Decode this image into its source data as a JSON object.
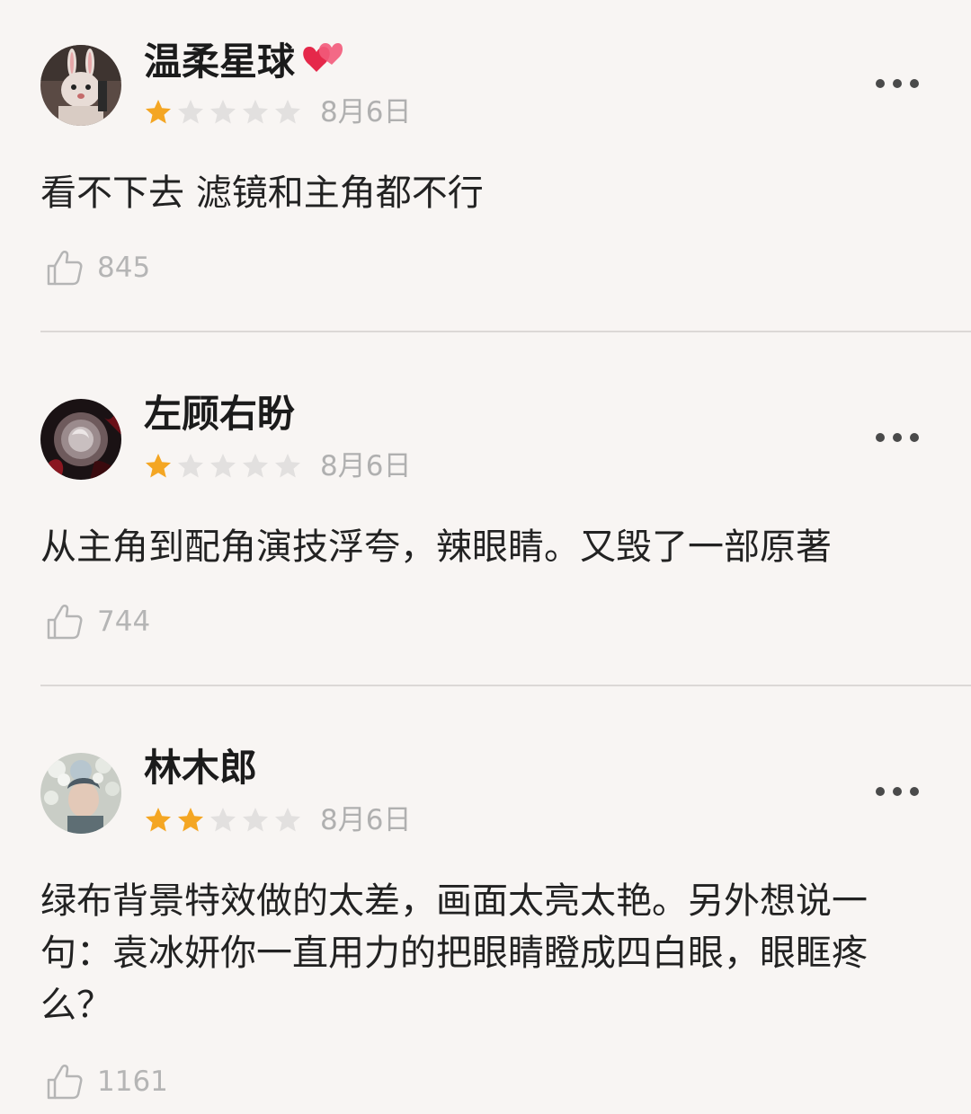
{
  "reviews": [
    {
      "username": "温柔星球",
      "username_emoji": "heart-icon",
      "rating": 1,
      "rating_max": 5,
      "date": "8月6日",
      "content": "看不下去 滤镜和主角都不行",
      "likes": "845"
    },
    {
      "username": "左顾右盼",
      "rating": 1,
      "rating_max": 5,
      "date": "8月6日",
      "content": "从主角到配角演技浮夸，辣眼睛。又毁了一部原著",
      "likes": "744"
    },
    {
      "username": "林木郎",
      "rating": 2,
      "rating_max": 5,
      "date": "8月6日",
      "content": "绿布背景特效做的太差，画面太亮太艳。另外想说一句：袁冰妍你一直用力的把眼睛瞪成四白眼，眼眶疼么？",
      "likes": "1161"
    }
  ],
  "colors": {
    "star_filled": "#f4a623",
    "star_empty": "#e2e0df",
    "background": "#f8f5f3",
    "muted_text": "#b0b0b0"
  }
}
